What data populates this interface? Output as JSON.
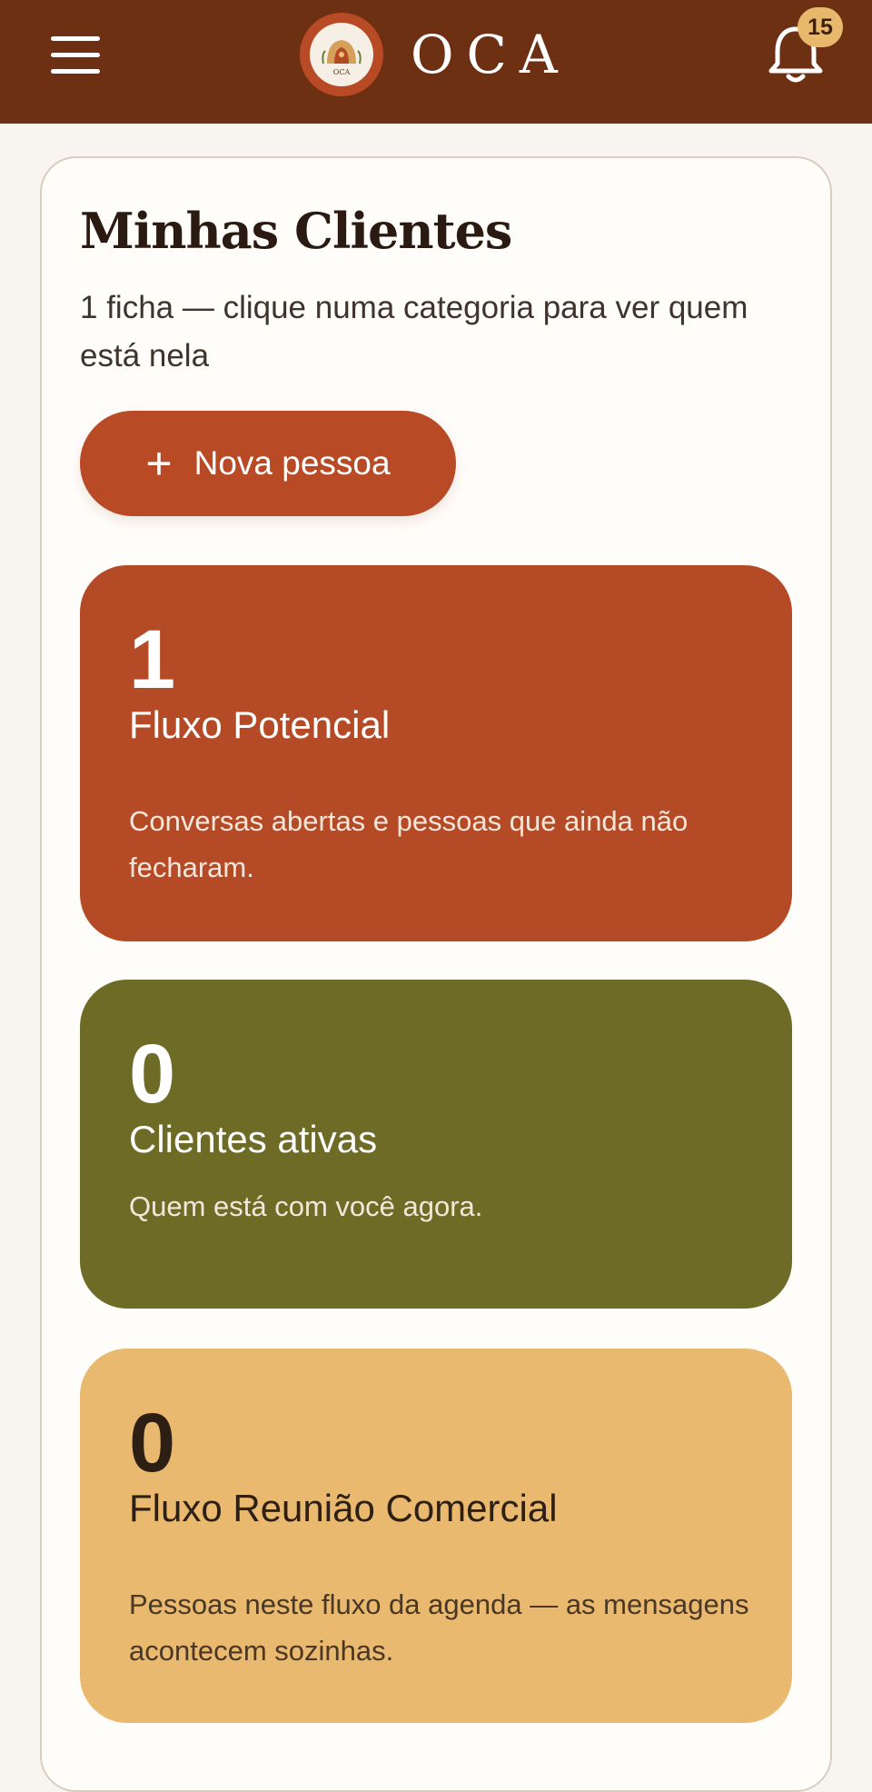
{
  "header": {
    "brand": "OCA",
    "logo_text": "OCA",
    "notification_count": "15"
  },
  "main": {
    "title": "Minhas Clientes",
    "subtitle": "1 ficha — clique numa categoria para ver quem está nela",
    "new_button_label": "Nova pessoa"
  },
  "categories": [
    {
      "count": "1",
      "name": "Fluxo Potencial",
      "description": "Conversas abertas e pessoas que ainda não fecharam.",
      "color": "#b54a26"
    },
    {
      "count": "0",
      "name": "Clientes ativas",
      "description": "Quem está com você agora.",
      "color": "#6e6b26"
    },
    {
      "count": "0",
      "name": "Fluxo Reunião Comercial",
      "description": "Pessoas neste fluxo da agenda — as mensagens acontecem sozinhas.",
      "color": "#e8b96e"
    }
  ],
  "colors": {
    "header_bg": "#6e3012",
    "accent": "#b84a26",
    "badge": "#e8b96d",
    "page_bg": "#f8f5f0"
  },
  "icons": [
    "hamburger-menu-icon",
    "logo-icon",
    "bell-icon",
    "plus-icon"
  ]
}
